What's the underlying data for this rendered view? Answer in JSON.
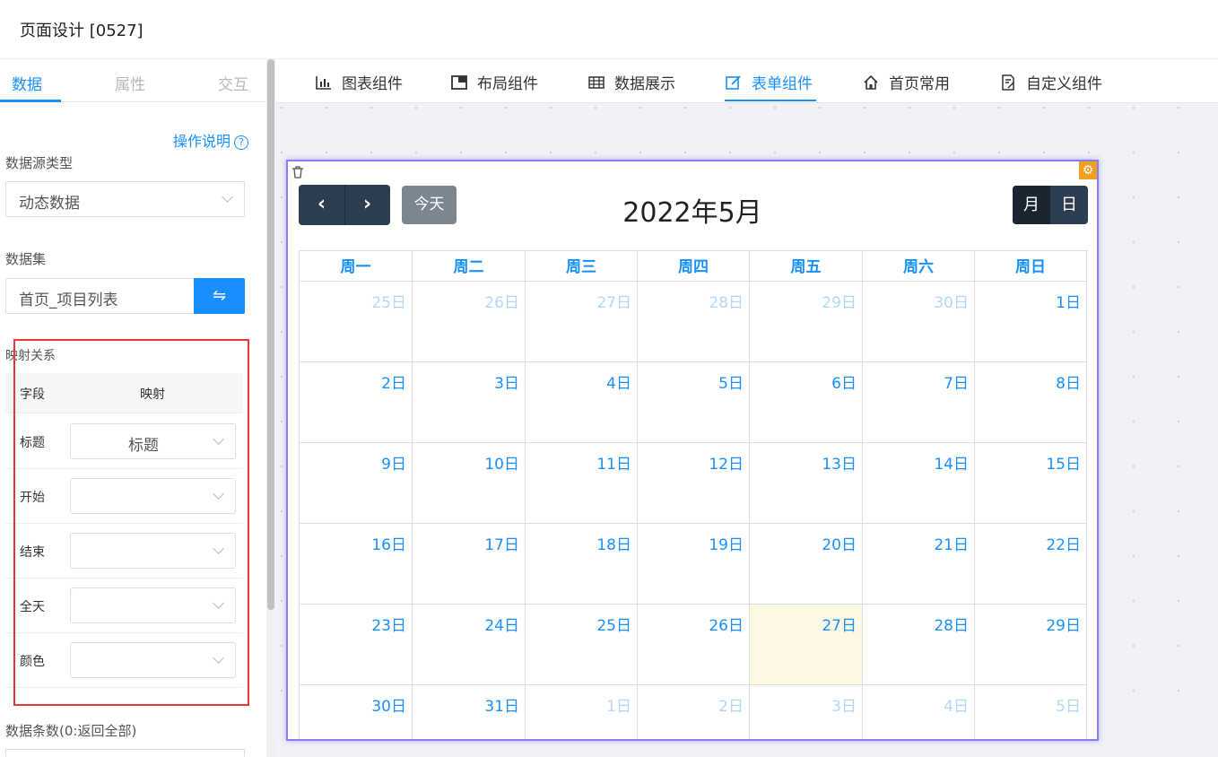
{
  "page": {
    "title": "页面设计 [0527]"
  },
  "left_panel": {
    "tabs": [
      "数据",
      "属性",
      "交互"
    ],
    "active_tab": "数据",
    "help_link": "操作说明",
    "help_icon": "question-circle-icon",
    "datasource_type": {
      "label": "数据源类型",
      "value": "动态数据"
    },
    "dataset": {
      "label": "数据集",
      "value": "首页_项目列表",
      "button_icon": "⇋"
    },
    "mapping": {
      "title": "映射关系",
      "headers": [
        "字段",
        "映射"
      ],
      "rows": [
        {
          "field": "标题",
          "value": "标题"
        },
        {
          "field": "开始",
          "value": ""
        },
        {
          "field": "结束",
          "value": ""
        },
        {
          "field": "全天",
          "value": ""
        },
        {
          "field": "颜色",
          "value": ""
        }
      ]
    },
    "count_label": "数据条数(0:返回全部)"
  },
  "main_tabs": [
    {
      "label": "图表组件",
      "icon": "bar-chart-icon"
    },
    {
      "label": "布局组件",
      "icon": "layout-icon"
    },
    {
      "label": "数据展示",
      "icon": "table-icon"
    },
    {
      "label": "表单组件",
      "icon": "edit-icon"
    },
    {
      "label": "首页常用",
      "icon": "home-icon"
    },
    {
      "label": "自定义组件",
      "icon": "custom-doc-icon"
    }
  ],
  "active_main_tab": "表单组件",
  "calendar": {
    "title": "2022年5月",
    "prev_label": "‹",
    "next_label": "›",
    "today_label": "今天",
    "views": [
      "月",
      "日"
    ],
    "active_view": "月",
    "weekdays": [
      "周一",
      "周二",
      "周三",
      "周四",
      "周五",
      "周六",
      "周日"
    ],
    "days": [
      "25日",
      "26日",
      "27日",
      "28日",
      "29日",
      "30日",
      "1日",
      "2日",
      "3日",
      "4日",
      "5日",
      "6日",
      "7日",
      "8日",
      "9日",
      "10日",
      "11日",
      "12日",
      "13日",
      "14日",
      "15日",
      "16日",
      "17日",
      "18日",
      "19日",
      "20日",
      "21日",
      "22日",
      "23日",
      "24日",
      "25日",
      "26日",
      "27日",
      "28日",
      "29日",
      "30日",
      "31日",
      "1日",
      "2日",
      "3日",
      "4日",
      "5日"
    ],
    "other_month_indices": [
      0,
      1,
      2,
      3,
      4,
      5,
      37,
      38,
      39,
      40,
      41
    ],
    "today_index": 32,
    "colors": {
      "accent": "#1890ff",
      "dark_button": "#2c3e50",
      "today_bg": "#fcf8e3",
      "selection_border": "#8b7cf6"
    }
  }
}
